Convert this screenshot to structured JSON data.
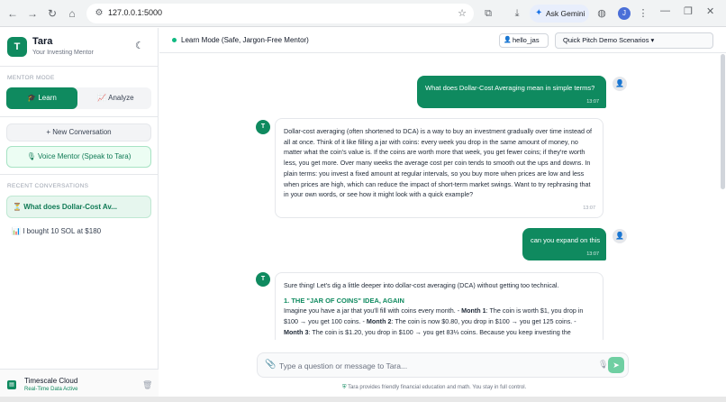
{
  "browser": {
    "url": "127.0.0.1:5000",
    "gemini_label": "Ask Gemini",
    "profile_initial": "J"
  },
  "sidebar": {
    "logo_letter": "T",
    "app_name": "Tara",
    "tagline": "Your Investing Mentor",
    "mentor_mode_label": "MENTOR MODE",
    "modes": [
      {
        "label": "Learn",
        "icon": "graduation-cap-icon",
        "active": true
      },
      {
        "label": "Analyze",
        "icon": "chart-icon",
        "active": false
      }
    ],
    "new_conversation": "+ New Conversation",
    "voice_mentor": "Voice Mentor (Speak to Tara)",
    "recent_label": "RECENT CONVERSATIONS",
    "conversations": [
      {
        "label": "What does Dollar-Cost Av...",
        "icon": "hourglass-icon",
        "active": true
      },
      {
        "label": "I bought 10 SOL at $180",
        "icon": "chart-icon",
        "active": false
      }
    ],
    "timescale": {
      "title": "Timescale Cloud",
      "subtitle": "Real-Time Data Active"
    }
  },
  "header": {
    "mode_title": "Learn Mode (Safe, Jargon-Free Mentor)",
    "username": "hello_jas",
    "scenario_select": "Quick Pitch Demo Scenarios"
  },
  "messages": [
    {
      "role": "user",
      "text": "What does Dollar-Cost Averaging mean in simple terms?",
      "time": "13:07"
    },
    {
      "role": "assistant",
      "avatar": "T",
      "text": "Dollar-cost averaging (often shortened to DCA) is a way to buy an investment gradually over time instead of all at once. Think of it like filling a jar with coins: every week you drop in the same amount of money, no matter what the coin's value is. If the coins are worth more that week, you get fewer coins; if they're worth less, you get more. Over many weeks the average cost per coin tends to smooth out the ups and downs. In plain terms: you invest a fixed amount at regular intervals, so you buy more when prices are low and less when prices are high, which can reduce the impact of short-term market swings. Want to try rephrasing that in your own words, or see how it might look with a quick example?",
      "time": "13:07"
    },
    {
      "role": "user",
      "text": "can you expand on this",
      "time": "13:07"
    },
    {
      "role": "assistant",
      "avatar": "T",
      "intro": "Sure thing! Let's dig a little deeper into dollar-cost averaging (DCA) without getting too technical.",
      "heading": "1. THE \"JAR OF COINS\" IDEA, AGAIN",
      "body_lead": "Imagine you have a jar that you'll fill with coins every month. - ",
      "m1_label": "Month 1",
      "m1_text": ": The coin is worth $1, you drop in $100 → you get 100 coins. - ",
      "m2_label": "Month 2",
      "m2_text": ": The coin is now $0.80, you drop in $100 → you get 125 coins. - ",
      "m3_label": "Month 3",
      "m3_text": ": The coin is $1.20, you drop in $100 → you get 83⅓ coins. Because you keep investing the"
    }
  ],
  "composer": {
    "placeholder": "Type a question or message to Tara...",
    "disclaimer": "Tara provides friendly financial education and math. You stay in full control."
  }
}
